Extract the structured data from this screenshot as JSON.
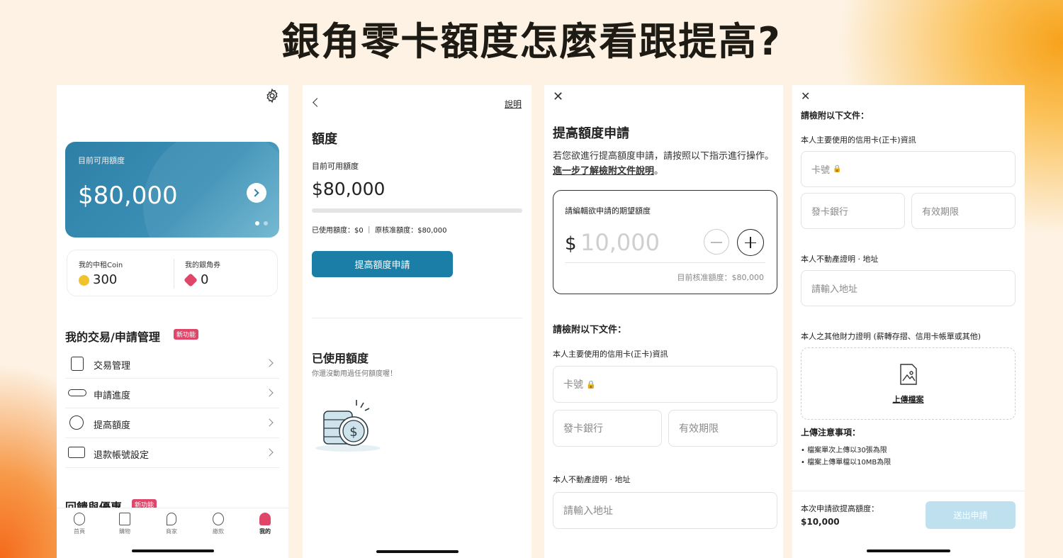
{
  "headline": "銀角零卡額度怎麼看跟提高?",
  "screen1": {
    "card": {
      "label": "目前可用額度",
      "amount": "$80,000"
    },
    "stats": [
      {
        "label": "我的中租Coin",
        "value": "300"
      },
      {
        "label": "我的銀角券",
        "value": "0"
      }
    ],
    "section_title": "我的交易/申請管理",
    "new_badge": "新功能",
    "menu": [
      {
        "label": "交易管理",
        "icon": "receipt-icon"
      },
      {
        "label": "申請進度",
        "icon": "search-progress-icon"
      },
      {
        "label": "提高額度",
        "icon": "raise-limit-icon"
      },
      {
        "label": "退款帳號設定",
        "icon": "refund-account-icon"
      }
    ],
    "section2_title": "回饋與優惠",
    "section2_badge": "新功能",
    "tabs": [
      {
        "label": "首頁",
        "icon": "home-icon"
      },
      {
        "label": "購物",
        "icon": "shopping-bag-icon"
      },
      {
        "label": "商家",
        "icon": "location-pin-icon"
      },
      {
        "label": "繳款",
        "icon": "payment-icon"
      },
      {
        "label": "我的",
        "icon": "user-icon"
      }
    ]
  },
  "screen2": {
    "help_link": "說明",
    "title": "額度",
    "available_label": "目前可用額度",
    "amount": "$80,000",
    "usage_text": "已使用額度：$0 ｜ 原核准額度：$80,000",
    "used_fraction": 0,
    "apply_button": "提高額度申請",
    "used_title": "已使用額度",
    "used_empty": "你還沒動用過任何額度喔！"
  },
  "screen3": {
    "title": "提高額度申請",
    "intro": "若您欲進行提高額度申請，請按照以下指示進行操作。",
    "intro_link": "進一步了解檢附文件說明",
    "intro_end": "。",
    "amount_label": "請編輯欲申請的期望額度",
    "currency": "$",
    "amount_placeholder": "10,000",
    "approved_text": "目前核准額度：$80,000",
    "docs_title": "請檢附以下文件：",
    "card_info_label": "本人主要使用的信用卡(正卡)資訊",
    "card_no": "卡號",
    "bank": "發卡銀行",
    "expiry": "有效期限",
    "address_label": "本人不動產證明 · 地址",
    "address_placeholder": "請輸入地址"
  },
  "screen4": {
    "docs_title": "請檢附以下文件：",
    "card_info_label": "本人主要使用的信用卡(正卡)資訊",
    "card_no": "卡號",
    "bank": "發卡銀行",
    "expiry": "有效期限",
    "address_label": "本人不動產證明 · 地址",
    "address_placeholder": "請輸入地址",
    "finance_label": "本人之其他財力證明 (薪轉存摺、信用卡帳單或其他)",
    "upload_label": "上傳檔案",
    "notes_title": "上傳注意事項：",
    "notes": [
      "檔案單次上傳以30張為限",
      "檔案上傳單檔以10MB為限"
    ],
    "footer_label": "本次申請欲提高額度：",
    "footer_amount": "$10,000",
    "submit_button": "送出申請"
  }
}
